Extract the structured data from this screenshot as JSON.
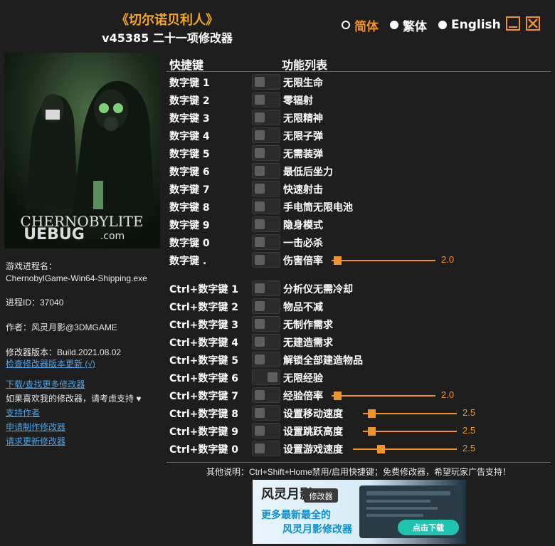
{
  "header": {
    "title": "《切尔诺贝利人》",
    "subtitle": "v45385 二十一项修改器"
  },
  "languages": [
    {
      "label": "简体",
      "selected": true
    },
    {
      "label": "繁体",
      "selected": false
    },
    {
      "label": "English",
      "selected": false
    }
  ],
  "cover": {
    "logo_text": "CHERNOBYLITE",
    "watermark": "UEBUG",
    "watermark_sub": ".com"
  },
  "sidebar": {
    "process_label": "游戏进程名：",
    "process_name": "ChernobylGame-Win64-Shipping.exe",
    "pid": "进程ID：37040",
    "author": "作者：风灵月影@3DMGAME",
    "version": "修改器版本：Build.2021.08.02",
    "check_update": "检查修改器版本更新 (√)",
    "download_more": "下载/查找更多修改器",
    "support_text": "如果喜欢我的修改器，请考虑支持",
    "support_author": "支持作者",
    "request_trainer": "申请制作修改器",
    "request_update": "请求更新修改器"
  },
  "table": {
    "col_hotkey": "快捷键",
    "col_func": "功能列表"
  },
  "rows": [
    {
      "key": "数字键 1",
      "func": "无限生命",
      "on": false
    },
    {
      "key": "数字键 2",
      "func": "零辐射",
      "on": false
    },
    {
      "key": "数字键 3",
      "func": "无限精神",
      "on": false
    },
    {
      "key": "数字键 4",
      "func": "无限子弹",
      "on": false
    },
    {
      "key": "数字键 5",
      "func": "无需装弹",
      "on": false
    },
    {
      "key": "数字键 6",
      "func": "最低后坐力",
      "on": false
    },
    {
      "key": "数字键 7",
      "func": "快速射击",
      "on": false
    },
    {
      "key": "数字键 8",
      "func": "手电筒无限电池",
      "on": false
    },
    {
      "key": "数字键 9",
      "func": "隐身模式",
      "on": false
    },
    {
      "key": "数字键 0",
      "func": "一击必杀",
      "on": false
    },
    {
      "key": "数字键 .",
      "func": "伤害倍率",
      "on": false,
      "slider": {
        "value": "2.0",
        "fraction": 0.05
      }
    },
    {
      "key": "Ctrl+数字键 1",
      "func": "分析仪无需冷却",
      "on": false
    },
    {
      "key": "Ctrl+数字键 2",
      "func": "物品不减",
      "on": false
    },
    {
      "key": "Ctrl+数字键 3",
      "func": "无制作需求",
      "on": false
    },
    {
      "key": "Ctrl+数字键 4",
      "func": "无建造需求",
      "on": false
    },
    {
      "key": "Ctrl+数字键 5",
      "func": "解锁全部建造物品",
      "on": false
    },
    {
      "key": "Ctrl+数字键 6",
      "func": "无限经验",
      "on": true
    },
    {
      "key": "Ctrl+数字键 7",
      "func": "经验倍率",
      "on": false,
      "slider": {
        "value": "2.0",
        "fraction": 0.05
      }
    },
    {
      "key": "Ctrl+数字键 8",
      "func": "设置移动速度",
      "on": false,
      "slider": {
        "value": "2.5",
        "fraction": 0.08
      }
    },
    {
      "key": "Ctrl+数字键 9",
      "func": "设置跳跃高度",
      "on": false,
      "slider": {
        "value": "2.5",
        "fraction": 0.08
      }
    },
    {
      "key": "Ctrl+数字键 0",
      "func": "设置游戏速度",
      "on": false,
      "slider": {
        "value": "2.5",
        "fraction": 0.26
      }
    }
  ],
  "footer": {
    "note": "其他说明：Ctrl+Shift+Home禁用/启用快捷键；免费修改器，希望玩家广告支持！"
  },
  "ad": {
    "brand": "风灵月影",
    "tag": "修改器",
    "line1": "更多最新最全的",
    "line2": "风灵月影修改器",
    "button": "点击下载"
  }
}
